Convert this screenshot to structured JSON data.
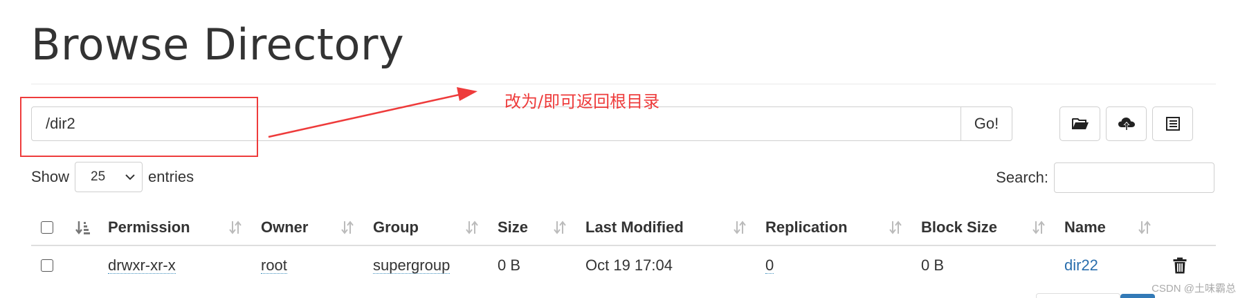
{
  "page": {
    "title": "Browse Directory"
  },
  "path_bar": {
    "value": "/dir2",
    "go_label": "Go!"
  },
  "toolbar": {
    "icons": [
      "folder-open-icon",
      "cloud-upload-icon",
      "list-icon"
    ]
  },
  "annotation": {
    "text": "改为/即可返回根目录",
    "color": "#ee3b3b"
  },
  "entries": {
    "show_label": "Show",
    "page_length": "25",
    "entries_label": "entries"
  },
  "search": {
    "label": "Search:",
    "value": ""
  },
  "table": {
    "columns": [
      "Permission",
      "Owner",
      "Group",
      "Size",
      "Last Modified",
      "Replication",
      "Block Size",
      "Name"
    ],
    "rows": [
      {
        "permission": "drwxr-xr-x",
        "owner": "root",
        "group": "supergroup",
        "size": "0 B",
        "last_modified": "Oct 19 17:04",
        "replication": "0",
        "block_size": "0 B",
        "name": "dir22"
      }
    ]
  },
  "watermark": "CSDN @土味霸总",
  "colors": {
    "link": "#2a6ead",
    "accent_partial": "#337ab7"
  }
}
